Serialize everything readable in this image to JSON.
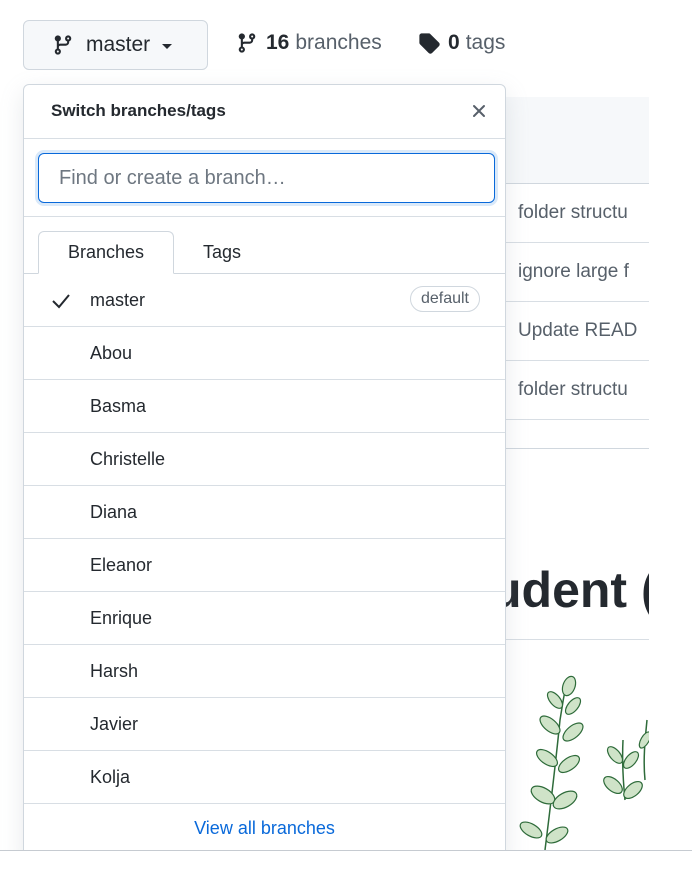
{
  "toolbar": {
    "branch_label": "master",
    "branches_count": "16",
    "branches_label": "branches",
    "tags_count": "0",
    "tags_label": "tags"
  },
  "dropdown": {
    "title": "Switch branches/tags",
    "search_placeholder": "Find or create a branch…",
    "tabs": {
      "branches": "Branches",
      "tags": "Tags"
    },
    "branches": [
      {
        "name": "master",
        "selected": true,
        "badge": "default"
      },
      {
        "name": "Abou"
      },
      {
        "name": "Basma"
      },
      {
        "name": "Christelle"
      },
      {
        "name": "Diana"
      },
      {
        "name": "Eleanor"
      },
      {
        "name": "Enrique"
      },
      {
        "name": "Harsh"
      },
      {
        "name": "Javier"
      },
      {
        "name": "Kolja"
      }
    ],
    "view_all": "View all branches"
  },
  "background": {
    "commits": [
      "folder structu",
      "ignore large f",
      "Update READ",
      "folder structu"
    ],
    "readme_heading_fragment": "udent ("
  },
  "colors": {
    "accent": "#0969da",
    "border": "#d0d7de",
    "muted": "#57606a"
  }
}
